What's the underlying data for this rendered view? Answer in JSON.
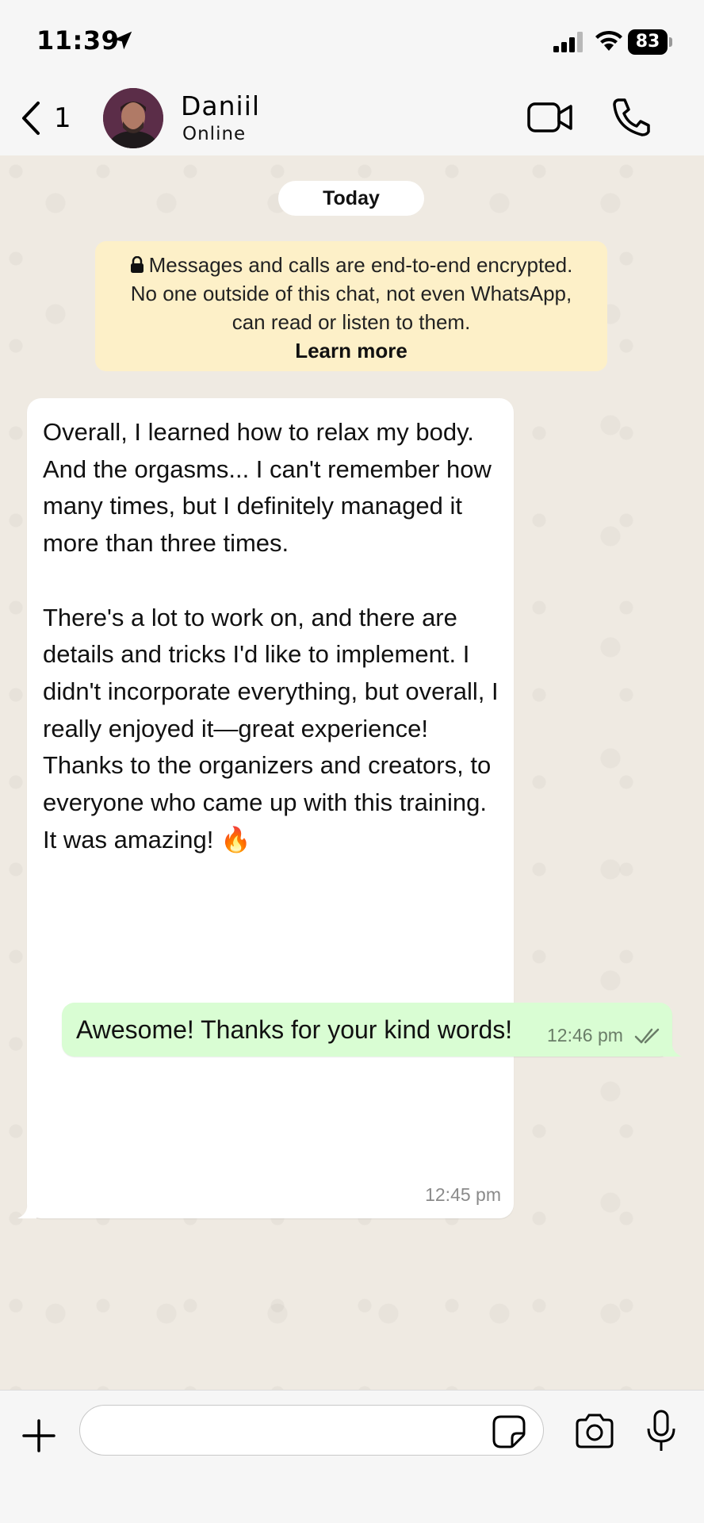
{
  "status_bar": {
    "time": "11:39",
    "battery": "83"
  },
  "header": {
    "back_count": "1",
    "contact_name": "Daniil",
    "contact_status": "Online"
  },
  "chat": {
    "date_chip": "Today",
    "encryption_notice": {
      "line1": "Messages and calls are end-to-end encrypted.",
      "line2": "No one outside of this chat, not even WhatsApp,",
      "line3": "can read or listen to them.",
      "learn_more": "Learn more"
    },
    "messages": [
      {
        "direction": "incoming",
        "text": "Overall, I learned how to relax my body. And the orgasms... I can't remember how many times, but I definitely managed it more than three times.\n\nThere's a lot to work on, and there are details and tricks I'd like to implement. I didn't incorporate everything, but overall, I really enjoyed it—great experience! Thanks to the organizers and creators, to everyone who came up with this training. It was amazing! 🔥",
        "time": "12:45 pm"
      },
      {
        "direction": "outgoing",
        "text": "Awesome! Thanks for your kind words!",
        "time": "12:46 pm",
        "status": "read"
      }
    ]
  },
  "input": {
    "placeholder": ""
  },
  "colors": {
    "chat_background": "#efeae2",
    "incoming_bubble": "#ffffff",
    "outgoing_bubble": "#d9fdd3",
    "encryption_notice_bg": "#fdf0c8",
    "read_tick": "#53bdeb"
  },
  "icons": {
    "location": "location-arrow-icon",
    "signal": "cellular-signal-icon",
    "wifi": "wifi-icon",
    "video": "video-camera-icon",
    "call": "phone-icon",
    "attach": "plus-icon",
    "sticker": "sticker-icon",
    "camera": "camera-icon",
    "mic": "microphone-icon"
  }
}
